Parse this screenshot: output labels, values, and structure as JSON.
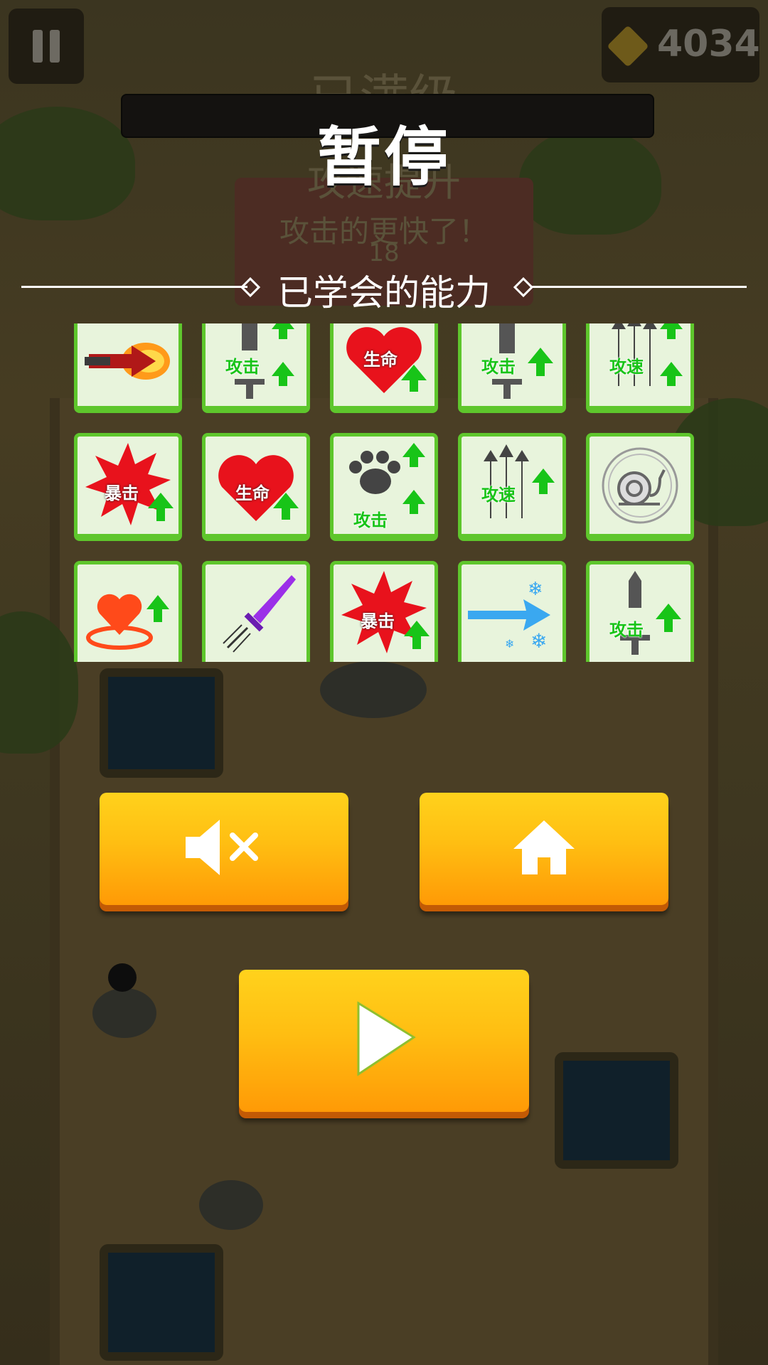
{
  "hud": {
    "coins": "4034",
    "pause_icon": "pause-icon",
    "coin_icon": "diamond-coin-icon"
  },
  "background_text": {
    "max_level": "已满级",
    "upgrade_name": "攻速提升",
    "upgrade_desc": "攻击的更快了！",
    "number": "18"
  },
  "overlay": {
    "title": "暂停",
    "section_label": "已学会的能力"
  },
  "abilities": [
    {
      "icon": "flaming-arrow-icon",
      "label": ""
    },
    {
      "icon": "sword-double-up-icon",
      "label": "攻击"
    },
    {
      "icon": "heart-up-icon",
      "label": "生命"
    },
    {
      "icon": "sword-up-icon",
      "label": "攻击"
    },
    {
      "icon": "arrows-double-up-icon",
      "label": "攻速"
    },
    {
      "icon": "critical-up-icon",
      "label": "暴击"
    },
    {
      "icon": "heart-up-icon",
      "label": "生命"
    },
    {
      "icon": "paw-double-up-icon",
      "label": "攻击"
    },
    {
      "icon": "arrows-up-icon",
      "label": "攻速"
    },
    {
      "icon": "snail-icon",
      "label": ""
    },
    {
      "icon": "heart-ring-up-icon",
      "label": ""
    },
    {
      "icon": "purple-sword-icon",
      "label": ""
    },
    {
      "icon": "critical-up-icon",
      "label": "暴击"
    },
    {
      "icon": "frost-arrow-icon",
      "label": ""
    },
    {
      "icon": "sword-up-icon",
      "label": "攻击"
    }
  ],
  "buttons": {
    "mute_icon": "speaker-mute-icon",
    "home_icon": "home-icon",
    "play_icon": "play-icon"
  },
  "colors": {
    "button_yellow": "#ffc414",
    "tile_green": "#5ec62c",
    "arrow_green": "#18c418",
    "heart_red": "#e8121c"
  }
}
